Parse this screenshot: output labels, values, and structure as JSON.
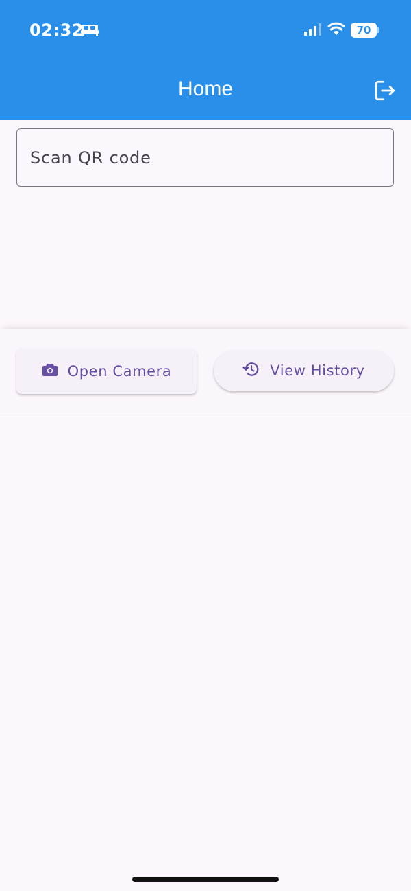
{
  "status_bar": {
    "time": "02:32",
    "battery": "70",
    "icons": [
      "sleep-bed-icon",
      "cellular-signal-icon",
      "wifi-icon",
      "battery-icon"
    ]
  },
  "app_bar": {
    "title": "Home",
    "logout_icon": "logout-icon",
    "color": "#2a8fe8"
  },
  "scan": {
    "placeholder": "Scan QR code",
    "value": ""
  },
  "actions": {
    "open_camera": {
      "label": "Open Camera",
      "icon": "camera-icon"
    },
    "view_history": {
      "label": "View History",
      "icon": "history-icon"
    },
    "accent": "#6750a4"
  }
}
